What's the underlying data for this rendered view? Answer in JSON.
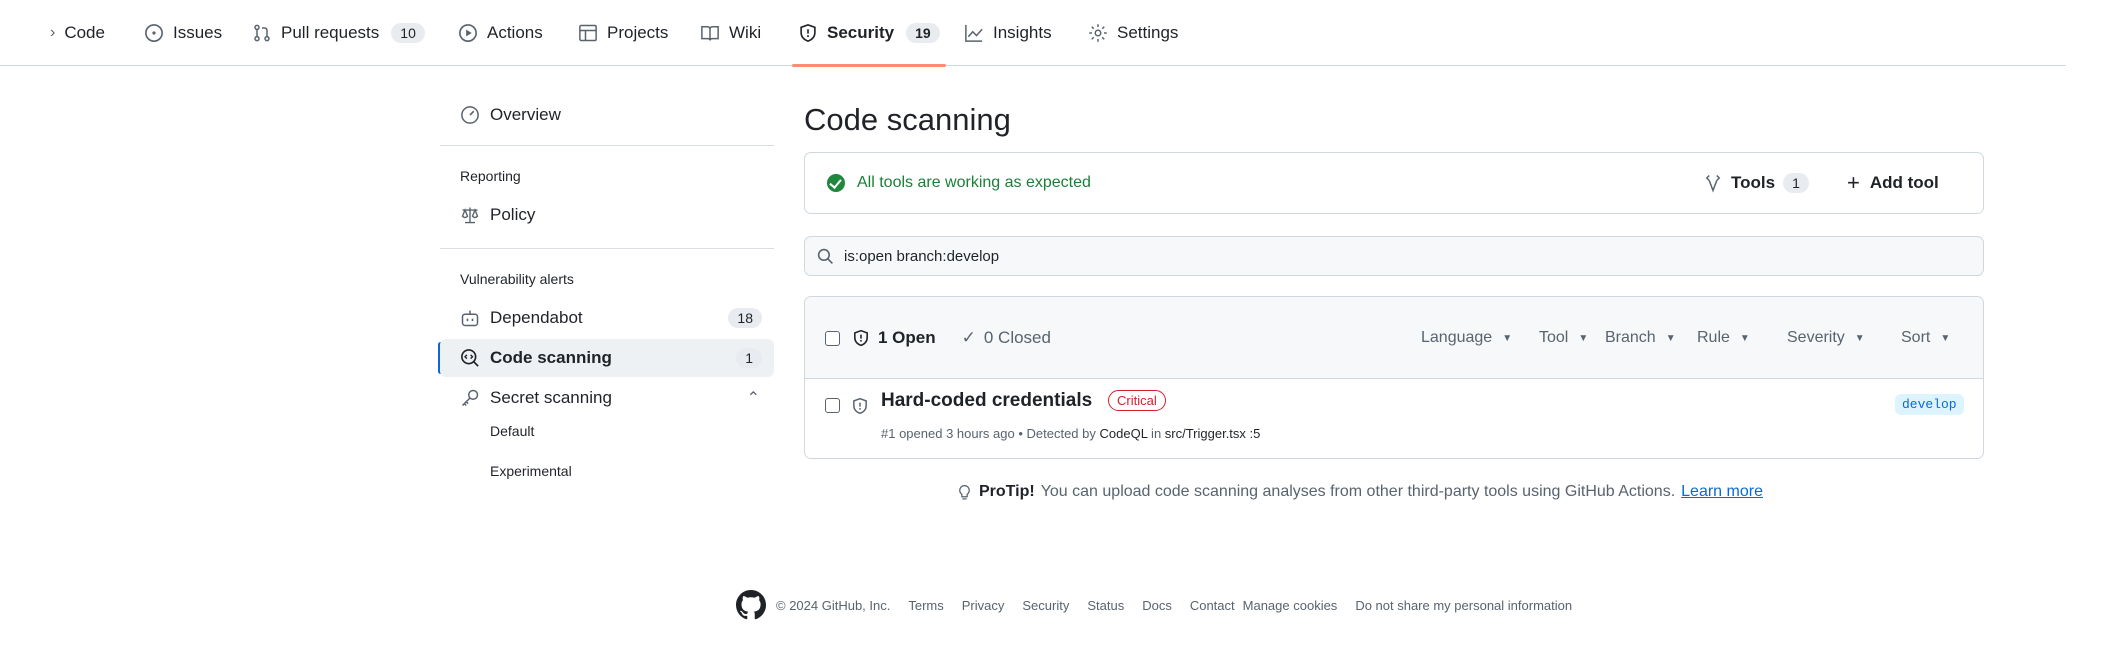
{
  "topnav": {
    "code": "Code",
    "issues": "Issues",
    "pulls": "Pull requests",
    "pulls_count": "10",
    "actions": "Actions",
    "projects": "Projects",
    "wiki": "Wiki",
    "security": "Security",
    "security_count": "19",
    "insights": "Insights",
    "settings": "Settings"
  },
  "sidebar": {
    "overview": "Overview",
    "reporting_heading": "Reporting",
    "policy": "Policy",
    "vuln_heading": "Vulnerability alerts",
    "dependabot": "Dependabot",
    "dependabot_count": "18",
    "code_scanning": "Code scanning",
    "code_scanning_count": "1",
    "secret_scanning": "Secret scanning",
    "secret_default": "Default",
    "secret_experimental": "Experimental"
  },
  "main": {
    "title": "Code scanning",
    "status_text": "All tools are working as expected",
    "tools_label": "Tools",
    "tools_count": "1",
    "add_tool": "Add tool",
    "search_value": "is:open branch:develop",
    "open_label": "1 Open",
    "closed_label": "0 Closed",
    "filters": [
      "Language",
      "Tool",
      "Branch",
      "Rule",
      "Severity",
      "Sort"
    ],
    "alert": {
      "title": "Hard-coded credentials",
      "severity": "Critical",
      "meta_prefix": "#1 opened 3 hours ago • Detected by ",
      "tool": "CodeQL",
      "meta_in": " in ",
      "location": "src/Trigger.tsx :5",
      "branch": "develop"
    },
    "protip_bold": "ProTip!",
    "protip_text": "You can upload code scanning analyses from other third-party tools using GitHub Actions.",
    "protip_link": "Learn more"
  },
  "footer": {
    "copyright": "© 2024 GitHub, Inc.",
    "links": [
      "Terms",
      "Privacy",
      "Security",
      "Status",
      "Docs",
      "Contact",
      "Manage cookies",
      "Do not share my personal information"
    ]
  },
  "colors": {
    "accent": "#0969da",
    "success": "#1a7f37",
    "danger": "#cf222e",
    "tab_underline": "#fd8c73"
  }
}
